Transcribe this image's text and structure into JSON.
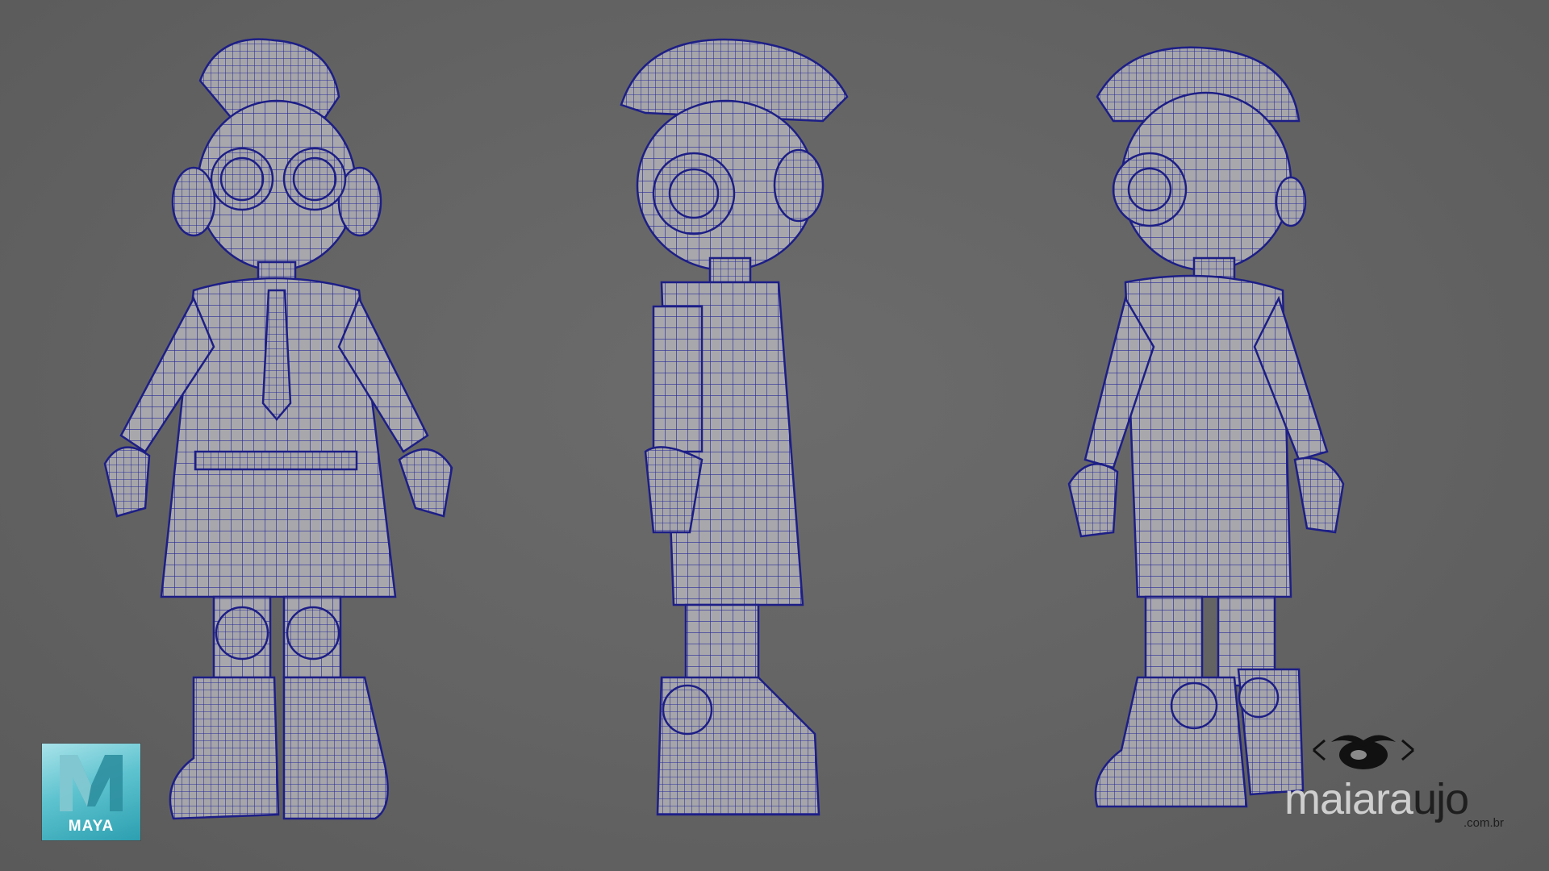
{
  "logo": {
    "app_name": "MAYA",
    "brand_color": "#4fb8c6"
  },
  "watermark": {
    "name_light": "maiara",
    "name_dark": "ujo",
    "domain": ".com.br"
  },
  "model": {
    "wire_color": "#27289a",
    "surface_color": "#a9a9ad",
    "views": [
      "front",
      "side",
      "back-three-quarter"
    ]
  },
  "background_color": "#646464"
}
